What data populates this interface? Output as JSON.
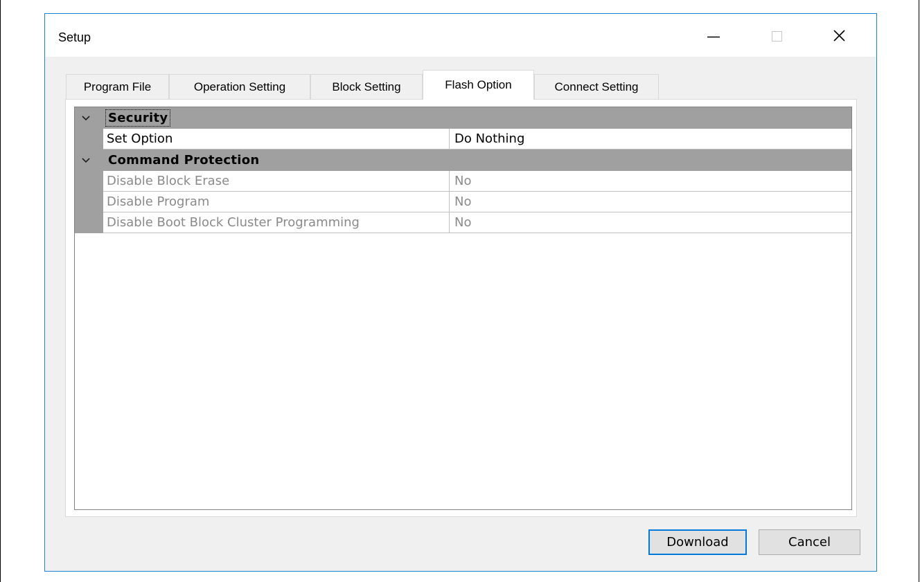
{
  "window": {
    "title": "Setup",
    "controls": [
      "minimize-icon",
      "maximize-icon",
      "close-icon"
    ]
  },
  "tabs": [
    {
      "label": "Program File",
      "active": false
    },
    {
      "label": "Operation Setting",
      "active": false
    },
    {
      "label": "Block Setting",
      "active": false
    },
    {
      "label": "Flash Option",
      "active": true
    },
    {
      "label": "Connect Setting",
      "active": false
    }
  ],
  "property_grid": {
    "categories": [
      {
        "label": "Security",
        "expanded": true,
        "rows": [
          {
            "name": "Set Option",
            "value": "Do Nothing",
            "enabled": true
          }
        ]
      },
      {
        "label": "Command Protection",
        "expanded": true,
        "rows": [
          {
            "name": "Disable Block Erase",
            "value": "No",
            "enabled": false
          },
          {
            "name": "Disable Program",
            "value": "No",
            "enabled": false
          },
          {
            "name": "Disable Boot Block Cluster Programming",
            "value": "No",
            "enabled": false
          }
        ]
      }
    ]
  },
  "buttons": {
    "download": "Download",
    "cancel": "Cancel"
  },
  "colors": {
    "accent": "#0078d7",
    "window_border": "#1883d7",
    "category_bg": "#a0a0a0",
    "disabled_text": "#8a8a8a"
  }
}
